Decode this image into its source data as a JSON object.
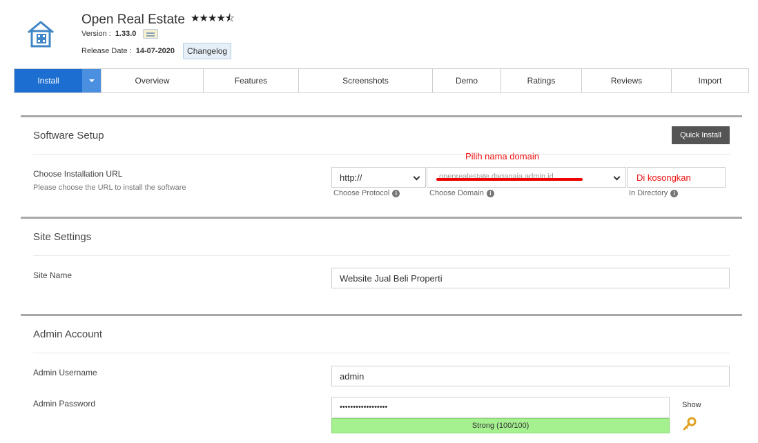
{
  "header": {
    "title": "Open Real Estate",
    "rating_stars": "★★★★⯪",
    "version_label": "Version :",
    "version_value": "1.33.0",
    "release_label": "Release Date :",
    "release_value": "14-07-2020",
    "changelog_label": "Changelog"
  },
  "tabs": [
    {
      "label": "Install"
    },
    {
      "label": "Overview"
    },
    {
      "label": "Features"
    },
    {
      "label": "Screenshots"
    },
    {
      "label": "Demo"
    },
    {
      "label": "Ratings"
    },
    {
      "label": "Reviews"
    },
    {
      "label": "Import"
    }
  ],
  "software_setup": {
    "title": "Software Setup",
    "quick_install": "Quick Install",
    "url_label": "Choose Installation URL",
    "url_sub": "Please choose the URL to install the software",
    "protocol_value": "http://",
    "protocol_hint": "Choose Protocol",
    "domain_value": "openrealestate.daganaja.admin.id",
    "domain_hint": "Choose Domain",
    "directory_hint": "In Directory",
    "annotation_domain": "Pilih nama domain",
    "annotation_directory": "Di kosongkan"
  },
  "site_settings": {
    "title": "Site Settings",
    "site_name_label": "Site Name",
    "site_name_value": "Website Jual Beli Properti"
  },
  "admin_account": {
    "title": "Admin Account",
    "username_label": "Admin Username",
    "username_value": "admin",
    "password_label": "Admin Password",
    "password_value": "••••••••••••••••••",
    "show_label": "Show",
    "strength_label": "Strong (100/100)"
  },
  "colors": {
    "accent": "#1c6fd1",
    "accent_light": "#4a8fe0",
    "strength_bg": "#a5f08f",
    "annotation": "#e11111"
  }
}
